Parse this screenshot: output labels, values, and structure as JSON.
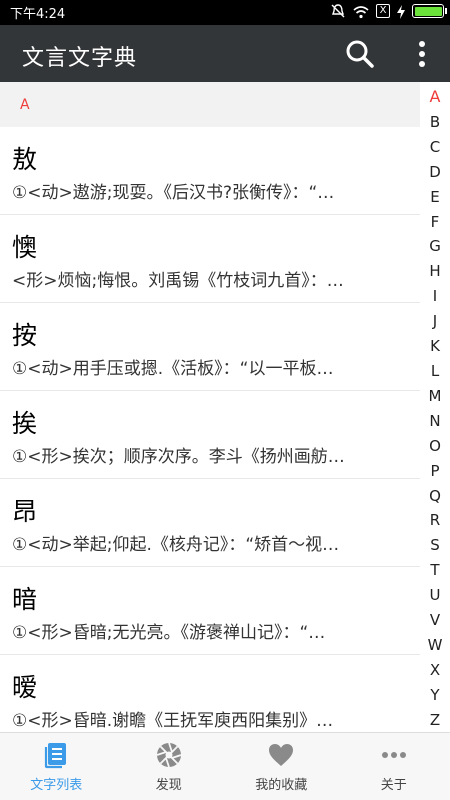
{
  "status_bar": {
    "time": "下午4:24",
    "sim_label": "X"
  },
  "app_bar": {
    "title": "文言文字典",
    "search_icon": "search-icon",
    "more_icon": "more-vert-icon"
  },
  "section": {
    "letter": "A"
  },
  "entries": [
    {
      "char": "敖",
      "definition": "①<动>遨游;现耍。《后汉书?张衡传》：“…"
    },
    {
      "char": "懊",
      "definition": "<形>烦恼;悔恨。刘禹锡《竹枝词九首》：…"
    },
    {
      "char": "按",
      "definition": "①<动>用手压或摁.《活板》：“以一平板…"
    },
    {
      "char": "挨",
      "definition": "①<形>挨次；顺序次序。李斗《扬州画舫…"
    },
    {
      "char": "昂",
      "definition": "①<动>举起;仰起.《核舟记》：“矫首～视…"
    },
    {
      "char": "暗",
      "definition": "①<形>昏暗;无光亮。《游褒禅山记》：“…"
    },
    {
      "char": "暧",
      "definition": "①<形>昏暗.谢瞻《王抚军庾西阳集别》…"
    }
  ],
  "index": {
    "letters": [
      "A",
      "B",
      "C",
      "D",
      "E",
      "F",
      "G",
      "H",
      "I",
      "J",
      "K",
      "L",
      "M",
      "N",
      "O",
      "P",
      "Q",
      "R",
      "S",
      "T",
      "U",
      "V",
      "W",
      "X",
      "Y",
      "Z"
    ],
    "active": "A",
    "active_color": "#ef3b3b"
  },
  "bottom_nav": {
    "items": [
      {
        "label": "文字列表",
        "icon": "book-list-icon"
      },
      {
        "label": "发现",
        "icon": "aperture-icon"
      },
      {
        "label": "我的收藏",
        "icon": "heart-icon"
      },
      {
        "label": "关于",
        "icon": "more-horiz-icon"
      }
    ],
    "active_color": "#3c9be8"
  }
}
